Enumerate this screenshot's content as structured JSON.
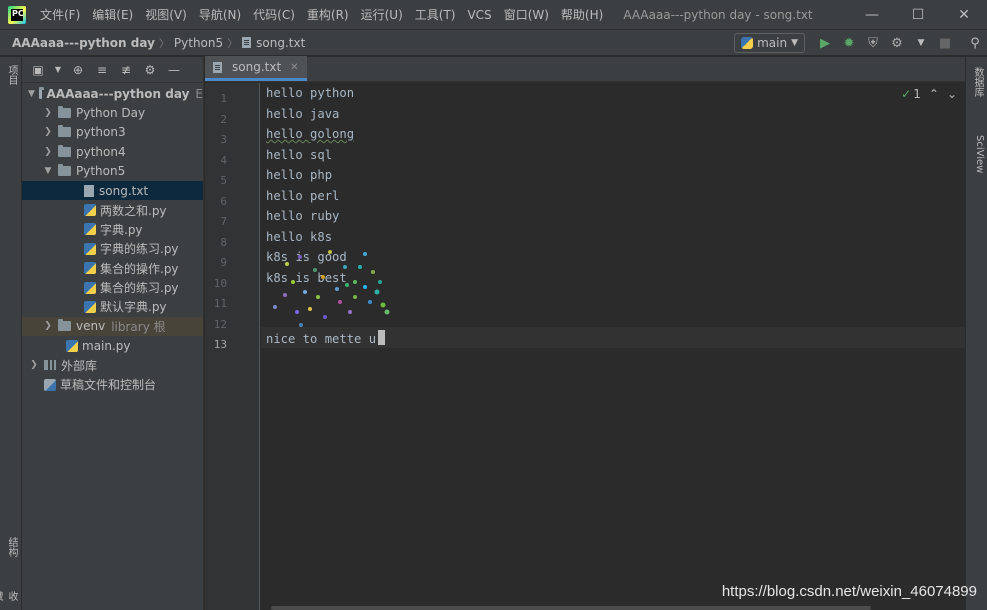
{
  "window": {
    "title": "AAAaaa---python day - song.txt",
    "menu": [
      "文件(F)",
      "编辑(E)",
      "视图(V)",
      "导航(N)",
      "代码(C)",
      "重构(R)",
      "运行(U)",
      "工具(T)",
      "VCS",
      "窗口(W)",
      "帮助(H)"
    ],
    "controls": [
      "minimize",
      "maximize",
      "close"
    ]
  },
  "navbar": {
    "breadcrumbs": [
      "AAAaaa---python day",
      "Python5",
      "song.txt"
    ],
    "run_config": "main"
  },
  "left_strip": {
    "tabs": [
      "项目",
      "结构",
      "收藏"
    ]
  },
  "right_strip": {
    "tabs": [
      "数据库",
      "SciView"
    ]
  },
  "project_tree": {
    "root": {
      "label": "AAAaaa---python day",
      "suffix": "E"
    },
    "items": [
      {
        "label": "Python Day",
        "kind": "folder",
        "depth": 1,
        "expanded": false
      },
      {
        "label": "python3",
        "kind": "folder",
        "depth": 1,
        "expanded": false
      },
      {
        "label": "python4",
        "kind": "folder",
        "depth": 1,
        "expanded": false
      },
      {
        "label": "Python5",
        "kind": "folder",
        "depth": 1,
        "expanded": true
      },
      {
        "label": "song.txt",
        "kind": "txt",
        "depth": 2,
        "selected": true
      },
      {
        "label": "两数之和.py",
        "kind": "py",
        "depth": 2
      },
      {
        "label": "字典.py",
        "kind": "py",
        "depth": 2
      },
      {
        "label": "字典的练习.py",
        "kind": "py",
        "depth": 2
      },
      {
        "label": "集合的操作.py",
        "kind": "py",
        "depth": 2
      },
      {
        "label": "集合的练习.py",
        "kind": "py",
        "depth": 2
      },
      {
        "label": "默认字典.py",
        "kind": "py",
        "depth": 2
      },
      {
        "label": "venv",
        "kind": "folder",
        "depth": 1,
        "expanded": false,
        "extra": "library 根",
        "excluded": true
      },
      {
        "label": "main.py",
        "kind": "py",
        "depth": 1
      }
    ],
    "external": "外部库",
    "scratches": "草稿文件和控制台"
  },
  "editor": {
    "tab": "song.txt",
    "inspection_count": "1",
    "lines": [
      "hello python",
      "hello java",
      "hello golong",
      "hello sql",
      "hello php",
      "hello perl",
      "hello ruby",
      "hello k8s",
      "k8s is good",
      "k8s is best",
      "",
      "",
      "nice to mette u"
    ],
    "current_line": 13
  },
  "watermark": "https://blog.csdn.net/weixin_46074899",
  "colors": {
    "accent": "#4a88c7",
    "selection": "#0d293e",
    "run_green": "#59a869"
  }
}
